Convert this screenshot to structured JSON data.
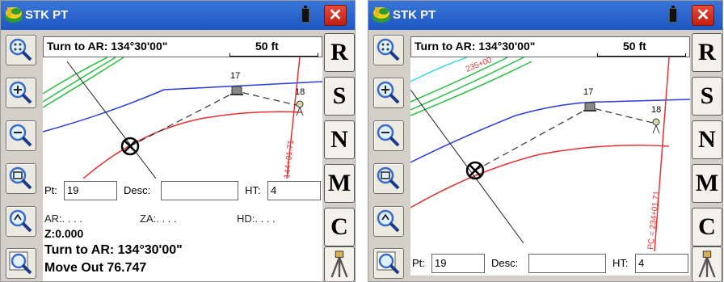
{
  "window": {
    "title": "STK PT",
    "close_label": "✕"
  },
  "infobar": {
    "turn_text": "Turn to AR: 134°30'00\"",
    "scale_text": "50 ft"
  },
  "right_buttons": [
    "R",
    "S",
    "N",
    "M",
    "C"
  ],
  "left_tools": [
    "zoom-extents-icon",
    "zoom-in-icon",
    "zoom-out-icon",
    "zoom-window-icon",
    "zoom-previous-icon",
    "zoom-current-icon"
  ],
  "map": {
    "point_17": "17",
    "point_18": "18",
    "left_station_label": "144+01.71",
    "right_station_label": "PC = 234+01.71",
    "right_top_label": "235+00"
  },
  "form": {
    "pt_label": "Pt:",
    "pt_value": "19",
    "desc_label": "Desc:",
    "desc_value": "",
    "ht_label": "HT:",
    "ht_value": "4"
  },
  "readout": {
    "ar": "AR:. . . .",
    "za": "ZA:. . . .",
    "hd": "HD:. . . .",
    "z": "Z:0.000",
    "turn": "Turn to AR: 134°30'00\"",
    "move": "Move Out 76.747"
  },
  "colors": {
    "titlebar": "#1d56c2",
    "close": "#d2281a",
    "red_line": "#e83030",
    "blue_line": "#2a3be0",
    "green_line": "#2cc040",
    "cyan_line": "#40d8e8"
  }
}
